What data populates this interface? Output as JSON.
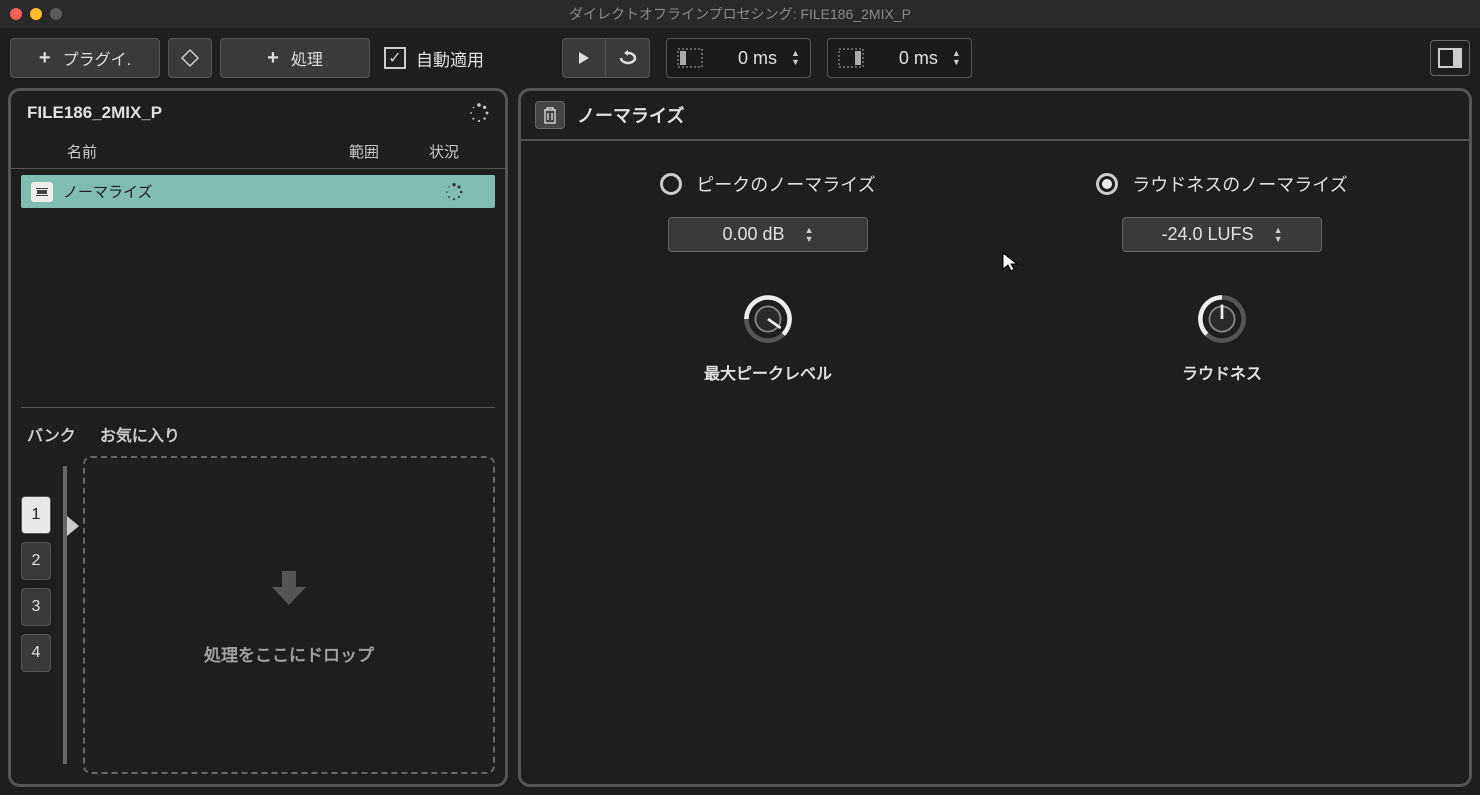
{
  "window": {
    "title": "ダイレクトオフラインプロセシング: FILE186_2MIX_P"
  },
  "toolbar": {
    "plugin_label": "プラグイ.",
    "process_label": "処理",
    "auto_apply_label": "自動適用",
    "time1_value": "0 ms",
    "time2_value": "0 ms"
  },
  "left_panel": {
    "file_title": "FILE186_2MIX_P",
    "columns": {
      "name": "名前",
      "range": "範囲",
      "status": "状況"
    },
    "processes": [
      {
        "name": "ノーマライズ"
      }
    ],
    "tabs": {
      "bank": "バンク",
      "favorites": "お気に入り"
    },
    "bank_slots": [
      "1",
      "2",
      "3",
      "4"
    ],
    "active_bank": "1",
    "dropzone_text": "処理をここにドロップ"
  },
  "right_panel": {
    "title": "ノーマライズ",
    "peak": {
      "radio_label": "ピークのノーマライズ",
      "value": "0.00 dB",
      "knob_label": "最大ピークレベル",
      "selected": false
    },
    "loudness": {
      "radio_label": "ラウドネスのノーマライズ",
      "value": "-24.0 LUFS",
      "knob_label": "ラウドネス",
      "selected": true
    }
  }
}
